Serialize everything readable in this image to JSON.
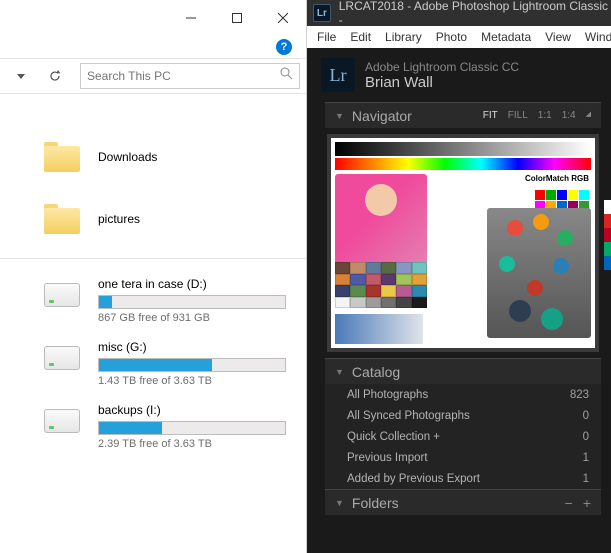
{
  "explorer": {
    "search_placeholder": "Search This PC",
    "folders": [
      {
        "name": "Downloads"
      },
      {
        "name": "pictures"
      }
    ],
    "drives": [
      {
        "name": "one tera in case (D:)",
        "free": "867 GB free of 931 GB",
        "pct": 7
      },
      {
        "name": "misc (G:)",
        "free": "1.43 TB free of 3.63 TB",
        "pct": 61
      },
      {
        "name": "backups (I:)",
        "free": "2.39 TB free of 3.63 TB",
        "pct": 34
      }
    ]
  },
  "lightroom": {
    "title": "LRCAT2018 - Adobe Photoshop Lightroom Classic -",
    "logo_text": "Lr",
    "menu": [
      "File",
      "Edit",
      "Library",
      "Photo",
      "Metadata",
      "View",
      "Windo"
    ],
    "product": "Adobe Lightroom Classic CC",
    "user": "Brian Wall",
    "navigator": {
      "title": "Navigator",
      "zoom": [
        "FIT",
        "FILL",
        "1:1",
        "1:4"
      ],
      "zoom_active": "FIT",
      "colormatch_label": "ColorMatch RGB"
    },
    "catalog": {
      "title": "Catalog",
      "rows": [
        {
          "label": "All Photographs",
          "count": "823"
        },
        {
          "label": "All Synced Photographs",
          "count": "0"
        },
        {
          "label": "Quick Collection  +",
          "count": "0"
        },
        {
          "label": "Previous Import",
          "count": "1"
        },
        {
          "label": "Added by Previous Export",
          "count": "1"
        }
      ]
    },
    "folders_panel": {
      "title": "Folders"
    }
  }
}
